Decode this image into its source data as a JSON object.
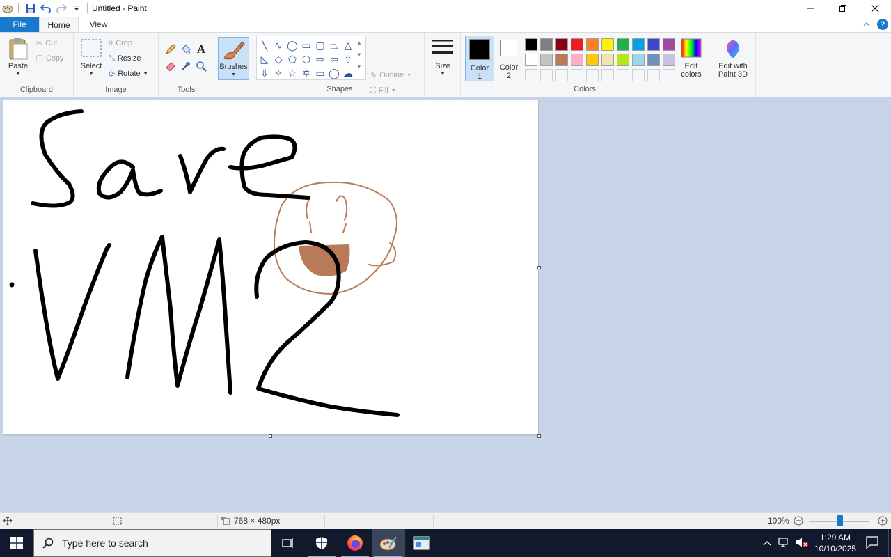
{
  "titlebar": {
    "title": "Untitled - Paint"
  },
  "tabs": {
    "file": "File",
    "home": "Home",
    "view": "View"
  },
  "ribbon": {
    "clipboard": {
      "paste": "Paste",
      "cut": "Cut",
      "copy": "Copy",
      "label": "Clipboard"
    },
    "image": {
      "select": "Select",
      "crop": "Crop",
      "resize": "Resize",
      "rotate": "Rotate",
      "label": "Image"
    },
    "tools": {
      "label": "Tools"
    },
    "brushes": {
      "label": "Brushes"
    },
    "shapes": {
      "outline": "Outline",
      "fill": "Fill",
      "label": "Shapes"
    },
    "size": {
      "label": "Size"
    },
    "color1": {
      "line1": "Color",
      "line2": "1"
    },
    "color2": {
      "line1": "Color",
      "line2": "2"
    },
    "colors": {
      "label": "Colors",
      "edit_line1": "Edit",
      "edit_line2": "colors",
      "palette_row1": [
        "#000000",
        "#7f7f7f",
        "#880015",
        "#ed1c24",
        "#ff7f27",
        "#fff200",
        "#22b14c",
        "#00a2e8",
        "#3f48cc",
        "#a349a4"
      ],
      "palette_row2": [
        "#ffffff",
        "#c3c3c3",
        "#b97a57",
        "#ffaec9",
        "#ffc90e",
        "#efe4b0",
        "#b5e61d",
        "#99d9ea",
        "#7092be",
        "#c8bfe7"
      ]
    },
    "paint3d": {
      "line1": "Edit with",
      "line2": "Paint 3D"
    }
  },
  "canvas": {
    "ink_color": "#000000",
    "brown_color": "#b97a57"
  },
  "status": {
    "dimensions": "768 × 480px",
    "zoom": "100%"
  },
  "taskbar": {
    "search_placeholder": "Type here to search",
    "time": "1:29 AM",
    "date": "10/10/2025"
  }
}
